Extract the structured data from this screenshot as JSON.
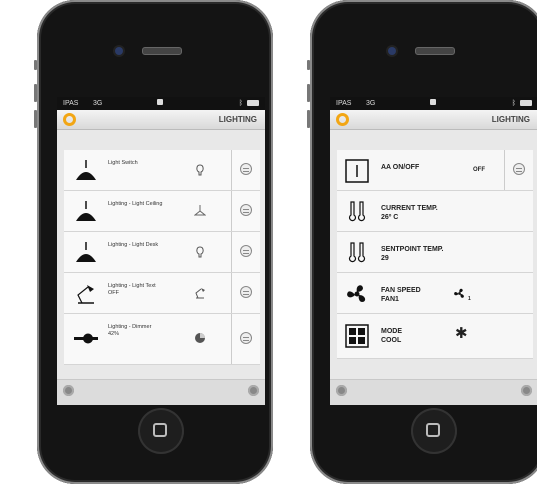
{
  "status_bar": {
    "carrier": "IPAS",
    "network": "3G"
  },
  "left_screen": {
    "title": "LIGHTING",
    "items": [
      {
        "name": "Light Switch",
        "value": ""
      },
      {
        "name": "Lighting - Light Ceiling",
        "value": ""
      },
      {
        "name": "Lighting - Light Desk",
        "value": ""
      },
      {
        "name": "Lighting - Light Text",
        "value": "OFF"
      },
      {
        "name": "Lighting - Dimmer",
        "value": "42%"
      }
    ]
  },
  "right_screen": {
    "title": "LIGHTING",
    "ac_onoff": {
      "label": "AA ON/OFF",
      "state": "OFF"
    },
    "current_temp": {
      "label": "CURRENT TEMP.",
      "value": "26º C"
    },
    "setpoint_temp": {
      "label": "SENTPOINT TEMP.",
      "value": "29"
    },
    "fan_speed": {
      "label": "FAN SPEED",
      "value": "FAN1",
      "level": "1"
    },
    "mode": {
      "label": "MODE",
      "value": "COOL"
    }
  },
  "colors": {
    "accent": "#f2a614",
    "row_bg": "#f9f9f9",
    "screen_bg": "#e8e8e8"
  }
}
